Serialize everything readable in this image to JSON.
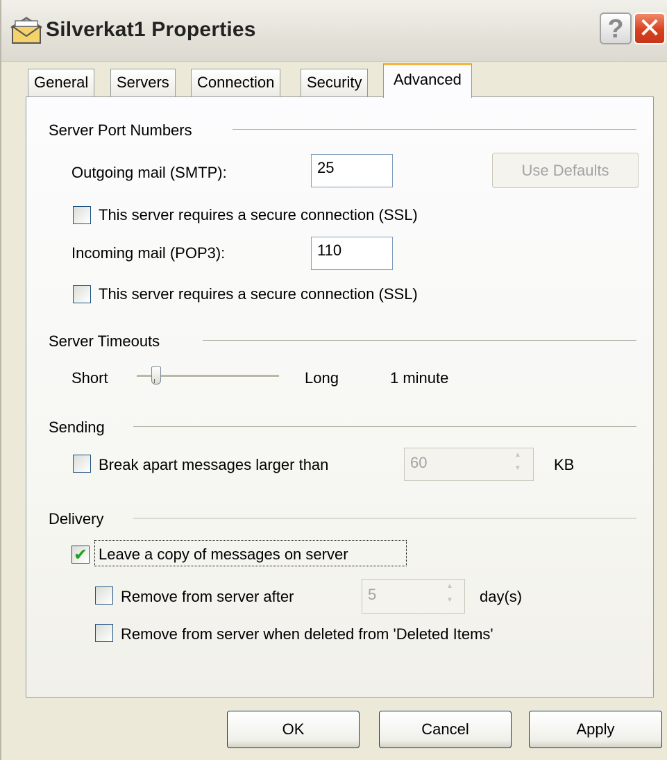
{
  "window": {
    "title": "Silverkat1 Properties"
  },
  "tabs": [
    {
      "label": "General"
    },
    {
      "label": "Servers"
    },
    {
      "label": "Connection"
    },
    {
      "label": "Security"
    },
    {
      "label": "Advanced",
      "active": true
    }
  ],
  "port_numbers": {
    "group_label": "Server Port Numbers",
    "outgoing_label": "Outgoing mail (SMTP):",
    "outgoing_value": "25",
    "use_defaults_label": "Use Defaults",
    "outgoing_ssl_label": "This server requires a secure connection (SSL)",
    "outgoing_ssl_checked": false,
    "incoming_label": "Incoming mail (POP3):",
    "incoming_value": "110",
    "incoming_ssl_label": "This server requires a secure connection (SSL)",
    "incoming_ssl_checked": false
  },
  "timeouts": {
    "group_label": "Server Timeouts",
    "short_label": "Short",
    "long_label": "Long",
    "value_text": "1 minute",
    "slider_fraction": 0.1
  },
  "sending": {
    "group_label": "Sending",
    "break_apart_label": "Break apart messages larger than",
    "break_apart_checked": false,
    "size_value": "60",
    "size_unit": "KB"
  },
  "delivery": {
    "group_label": "Delivery",
    "leave_copy_label": "Leave a copy of messages on server",
    "leave_copy_checked": true,
    "remove_after_label": "Remove from server after",
    "remove_after_checked": false,
    "days_value": "5",
    "days_unit": "day(s)",
    "remove_deleted_label": "Remove from server when deleted from 'Deleted Items'",
    "remove_deleted_checked": false
  },
  "footer": {
    "ok_label": "OK",
    "cancel_label": "Cancel",
    "apply_label": "Apply"
  },
  "icons": {
    "title": "envelope-stack-icon",
    "help": "help-icon",
    "close": "close-icon"
  },
  "colors": {
    "active_tab_accent": "#f2b43c",
    "close_button": "#d8401f",
    "checkbox_check": "#21a121",
    "dialog_background": "#ece9d8"
  }
}
